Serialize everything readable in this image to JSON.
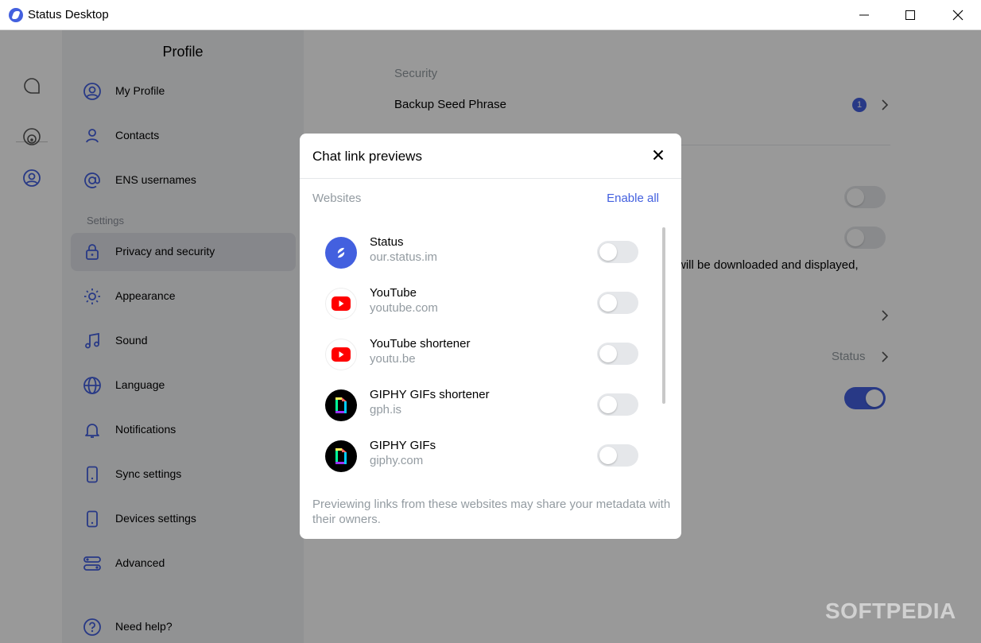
{
  "window": {
    "title": "Status Desktop"
  },
  "sidebar": {
    "title": "Profile",
    "section_label": "Settings",
    "items": [
      {
        "label": "My Profile",
        "icon": "profile-icon"
      },
      {
        "label": "Contacts",
        "icon": "person-icon"
      },
      {
        "label": "ENS usernames",
        "icon": "at-sign-icon"
      },
      {
        "label": "Privacy and security",
        "icon": "lock-icon",
        "active": true
      },
      {
        "label": "Appearance",
        "icon": "sun-icon"
      },
      {
        "label": "Sound",
        "icon": "music-note-icon"
      },
      {
        "label": "Language",
        "icon": "globe-icon"
      },
      {
        "label": "Notifications",
        "icon": "bell-icon"
      },
      {
        "label": "Sync settings",
        "icon": "phone-icon"
      },
      {
        "label": "Devices settings",
        "icon": "phone-icon"
      },
      {
        "label": "Advanced",
        "icon": "sliders-icon"
      },
      {
        "label": "Need help?",
        "icon": "help-icon"
      }
    ]
  },
  "main": {
    "section_security": "Security",
    "backup_seed_phrase": "Backup Seed Phrase",
    "backup_badge": "1",
    "partial_text": "will be downloaded and displayed,",
    "status_value": "Status"
  },
  "modal": {
    "title": "Chat link previews",
    "websites_label": "Websites",
    "enable_all": "Enable all",
    "sites": [
      {
        "name": "Status",
        "url": "our.status.im",
        "icon": "status-logo-icon",
        "enabled": false
      },
      {
        "name": "YouTube",
        "url": "youtube.com",
        "icon": "youtube-icon",
        "enabled": false
      },
      {
        "name": "YouTube shortener",
        "url": "youtu.be",
        "icon": "youtube-icon",
        "enabled": false
      },
      {
        "name": "GIPHY GIFs shortener",
        "url": "gph.is",
        "icon": "giphy-icon",
        "enabled": false
      },
      {
        "name": "GIPHY GIFs",
        "url": "giphy.com",
        "icon": "giphy-icon",
        "enabled": false
      }
    ],
    "footer": "Previewing links from these websites may share your metadata with their owners."
  },
  "watermark": "SOFTPEDIA",
  "colors": {
    "accent": "#4360df",
    "youtube_red": "#ff0000",
    "muted_text": "#939ba1"
  }
}
